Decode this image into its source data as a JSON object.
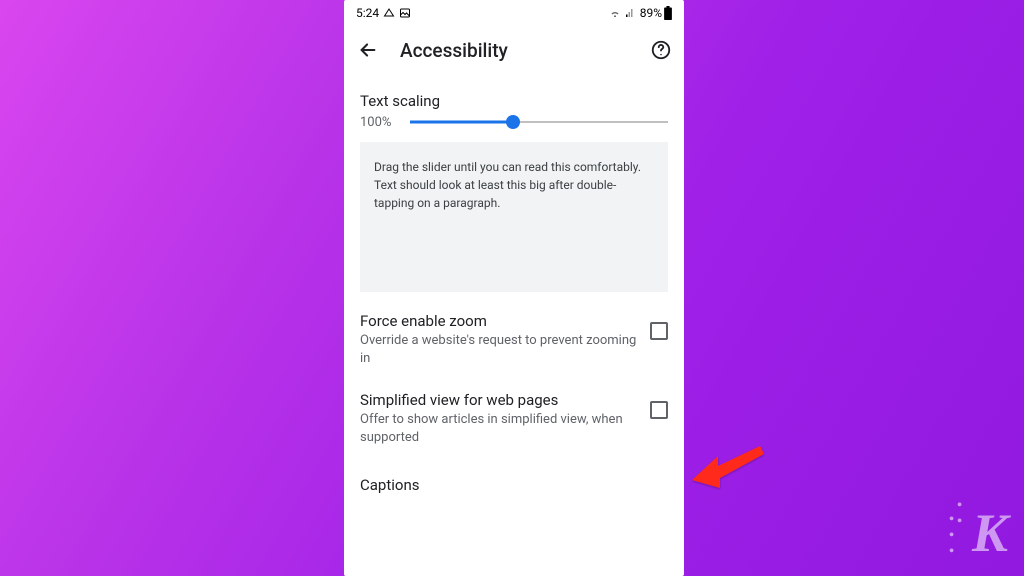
{
  "statusbar": {
    "time": "5:24",
    "battery": "89%"
  },
  "appbar": {
    "title": "Accessibility"
  },
  "textScaling": {
    "label": "Text scaling",
    "value": "100%",
    "preview": "Drag the slider until you can read this comfortably. Text should look at least this big after double-tapping on a paragraph."
  },
  "settings": {
    "forceZoom": {
      "title": "Force enable zoom",
      "desc": "Override a website's request to prevent zooming in"
    },
    "simplifiedView": {
      "title": "Simplified view for web pages",
      "desc": "Offer to show articles in simplified view, when supported"
    },
    "captions": {
      "title": "Captions"
    }
  },
  "watermark": "K"
}
